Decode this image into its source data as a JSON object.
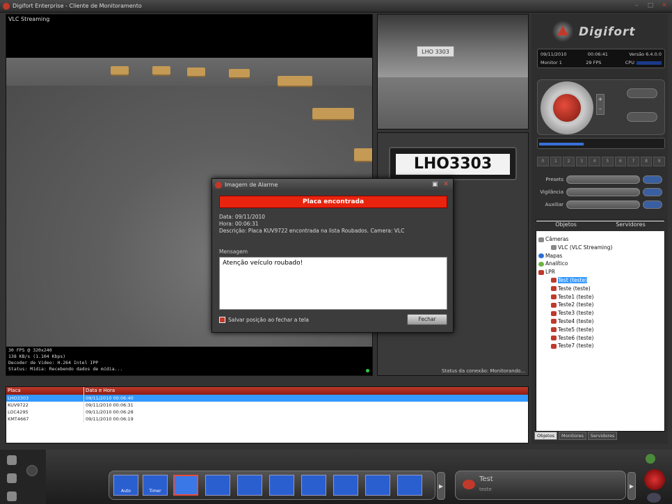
{
  "window": {
    "title": "Digifort Enterprise - Cliente de Monitoramento"
  },
  "video": {
    "title": "VLC Streaming",
    "overlay_lines": [
      "30 FPS @ 320x240",
      "138 KB/s (1.104 Kbps)",
      "Decoder de Video: H.264 Intel IPP",
      "Status: Mídia: Recebendo dados de mídia..."
    ]
  },
  "plate": {
    "snapshot_text": "LHO 3303",
    "recognized": "LHO3303"
  },
  "connection_status": "Status da conexão: Monitorando...",
  "alarm_dialog": {
    "title": "Imagem de Alarme",
    "banner": "Placa encontrada",
    "info": [
      "Data: 09/11/2010",
      "Hora: 00:06:31",
      "Descrição: Placa KUV9722 encontrada na lista Roubados. Camera: VLC"
    ],
    "message_label": "Mensagem",
    "message": "Atenção veículo roubado!",
    "save_position_label": "Salvar posição ao fechar a tela",
    "close_label": "Fechar"
  },
  "results": {
    "headers": [
      "Placa",
      "Data e Hora"
    ],
    "rows": [
      {
        "plate": "LHO3303",
        "datetime": "09/11/2010 00:06:40",
        "selected": true
      },
      {
        "plate": "KUV9722",
        "datetime": "09/11/2010 00:06:31"
      },
      {
        "plate": "LOC4295",
        "datetime": "09/11/2010 00:06:28"
      },
      {
        "plate": "KMT4667",
        "datetime": "09/11/2010 00:06:19"
      }
    ]
  },
  "sidebar": {
    "logo_text": "Digifort",
    "info": {
      "date": "09/11/2010",
      "time": "00:06:41",
      "version": "Versão 6.4.0.0",
      "monitor": "Monitor 1",
      "fps": "29 FPS",
      "cpu_label": "CPU"
    },
    "preset_numbers": [
      "0",
      "1",
      "2",
      "3",
      "4",
      "5",
      "6",
      "7",
      "8",
      "9"
    ],
    "selectors": {
      "presets": "Presets",
      "vigilancia": "Vigilância",
      "auxiliar": "Auxiliar"
    },
    "tree_tabs": {
      "objects": "Objetos",
      "servers": "Servidores"
    },
    "tree": [
      {
        "label": "Câmeras",
        "indent": 0,
        "icon": "cam"
      },
      {
        "label": "VLC (VLC Streaming)",
        "indent": 2,
        "icon": "cam"
      },
      {
        "label": "Mapas",
        "indent": 0,
        "icon": "blue"
      },
      {
        "label": "Analítico",
        "indent": 0,
        "icon": "green"
      },
      {
        "label": "LPR",
        "indent": 0,
        "icon": "red"
      },
      {
        "label": "Test (teste)",
        "indent": 2,
        "icon": "red",
        "selected": true
      },
      {
        "label": "Teste (teste)",
        "indent": 2,
        "icon": "red"
      },
      {
        "label": "Teste1 (teste)",
        "indent": 2,
        "icon": "red"
      },
      {
        "label": "Teste2 (teste)",
        "indent": 2,
        "icon": "red"
      },
      {
        "label": "Teste3 (teste)",
        "indent": 2,
        "icon": "red"
      },
      {
        "label": "Teste4 (teste)",
        "indent": 2,
        "icon": "red"
      },
      {
        "label": "Teste5 (teste)",
        "indent": 2,
        "icon": "red"
      },
      {
        "label": "Teste6 (teste)",
        "indent": 2,
        "icon": "red"
      },
      {
        "label": "Teste7 (teste)",
        "indent": 2,
        "icon": "red"
      }
    ],
    "bottom_tabs": [
      "Objetos",
      "Monitores",
      "Servidores"
    ]
  },
  "toolbar": {
    "layout_labels": {
      "auto": "Auto",
      "timer": "Timer"
    },
    "sequence": {
      "name": "Test",
      "sub": "teste"
    }
  }
}
